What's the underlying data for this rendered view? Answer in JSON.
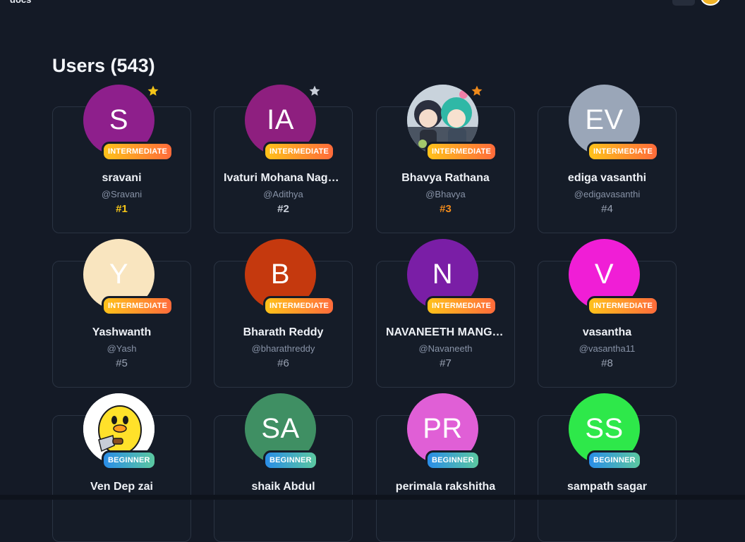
{
  "app": {
    "brand": "docs"
  },
  "page": {
    "title": "Users (543)"
  },
  "colors": {
    "background": "#141a26",
    "card": "#151c28",
    "gold": "#f5c518",
    "silver": "#c9cfd9",
    "bronze": "#f08a1b"
  },
  "users": [
    {
      "initials": "S",
      "avatar_color": "#8e1f8c",
      "level": "INTERMEDIATE",
      "name": "sravani",
      "handle": "@Sravani",
      "rank": "#1",
      "star": "gold"
    },
    {
      "initials": "IA",
      "avatar_color": "#8e1f7f",
      "level": "INTERMEDIATE",
      "name": "Ivaturi Mohana Naga...",
      "handle": "@Adithya",
      "rank": "#2",
      "star": "silver"
    },
    {
      "initials": "",
      "avatar_color": "#5c6b8a",
      "avatar_image": "anime-figures",
      "level": "INTERMEDIATE",
      "name": "Bhavya Rathana",
      "handle": "@Bhavya",
      "rank": "#3",
      "star": "bronze"
    },
    {
      "initials": "EV",
      "avatar_color": "#9aa6b8",
      "level": "INTERMEDIATE",
      "name": "ediga vasanthi",
      "handle": "@edigavasanthi",
      "rank": "#4",
      "star": ""
    },
    {
      "initials": "Y",
      "avatar_color": "#f9e5bf",
      "level": "INTERMEDIATE",
      "name": "Yashwanth",
      "handle": "@Yash",
      "rank": "#5",
      "star": ""
    },
    {
      "initials": "B",
      "avatar_color": "#c5390e",
      "level": "INTERMEDIATE",
      "name": "Bharath Reddy",
      "handle": "@bharathreddy",
      "rank": "#6",
      "star": ""
    },
    {
      "initials": "N",
      "avatar_color": "#7a1ea6",
      "level": "INTERMEDIATE",
      "name": "NAVANEETH MANGALI",
      "handle": "@Navaneeth",
      "rank": "#7",
      "star": ""
    },
    {
      "initials": "V",
      "avatar_color": "#f01ed6",
      "level": "INTERMEDIATE",
      "name": "vasantha",
      "handle": "@vasantha11",
      "rank": "#8",
      "star": ""
    },
    {
      "initials": "",
      "avatar_color": "#ffffff",
      "avatar_image": "yellow-duck-with-knife",
      "level": "BEGINNER",
      "name": "Ven Dep zai",
      "handle": "",
      "rank": "",
      "star": ""
    },
    {
      "initials": "SA",
      "avatar_color": "#3f8f63",
      "level": "BEGINNER",
      "name": "shaik Abdul",
      "handle": "",
      "rank": "",
      "star": ""
    },
    {
      "initials": "PR",
      "avatar_color": "#e05fd6",
      "level": "BEGINNER",
      "name": "perimala rakshitha",
      "handle": "",
      "rank": "",
      "star": ""
    },
    {
      "initials": "SS",
      "avatar_color": "#2ee84a",
      "level": "BEGINNER",
      "name": "sampath sagar",
      "handle": "",
      "rank": "",
      "star": ""
    }
  ]
}
